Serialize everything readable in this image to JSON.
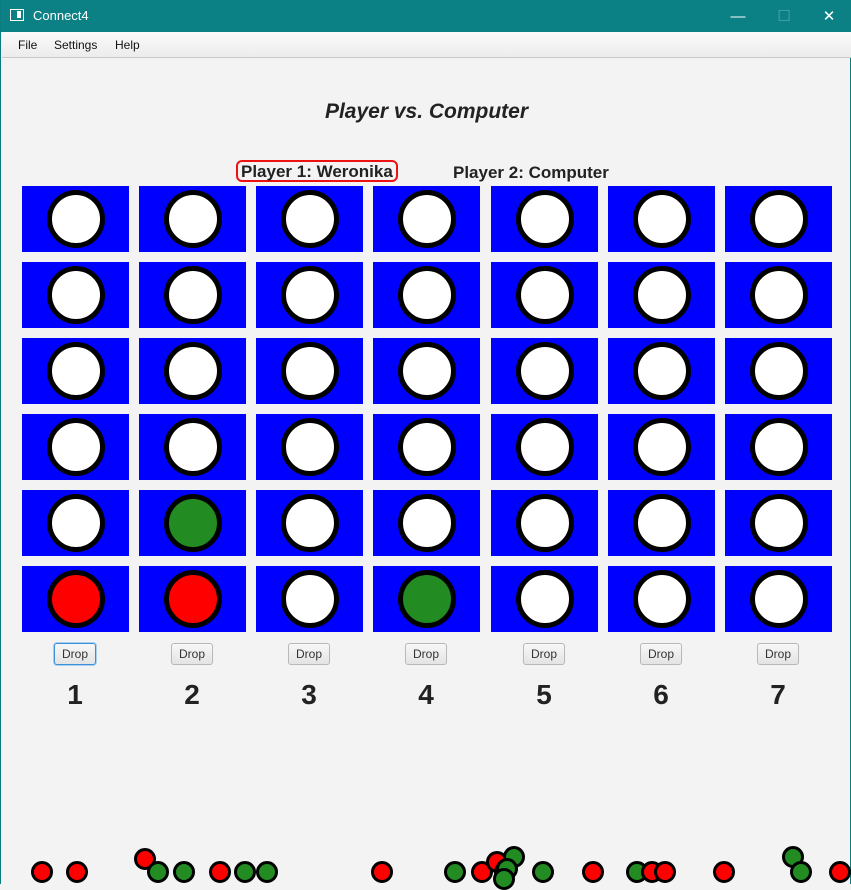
{
  "window": {
    "title": "Connect4",
    "minimize_icon": "minimize-icon",
    "maximize_icon": "maximize-icon",
    "close_icon": "close-icon",
    "minimize_glyph": "—",
    "maximize_glyph": "☐",
    "close_glyph": "✕"
  },
  "menu": [
    "File",
    "Settings",
    "Help"
  ],
  "game": {
    "mode_title": "Player vs. Computer",
    "player1": "Player 1: Weronika",
    "player2": "Player 2: Computer",
    "active_player": 1
  },
  "colors": {
    "board": "#0000ff",
    "empty": "#ffffff",
    "red": "#ff0000",
    "green": "#228b22",
    "active_highlight": "#ee1111"
  },
  "board": {
    "rows": 6,
    "cols": 7,
    "grid": [
      [
        "empty",
        "empty",
        "empty",
        "empty",
        "empty",
        "empty",
        "empty"
      ],
      [
        "empty",
        "empty",
        "empty",
        "empty",
        "empty",
        "empty",
        "empty"
      ],
      [
        "empty",
        "empty",
        "empty",
        "empty",
        "empty",
        "empty",
        "empty"
      ],
      [
        "empty",
        "empty",
        "empty",
        "empty",
        "empty",
        "empty",
        "empty"
      ],
      [
        "empty",
        "green",
        "empty",
        "empty",
        "empty",
        "empty",
        "empty"
      ],
      [
        "red",
        "red",
        "empty",
        "green",
        "empty",
        "empty",
        "empty"
      ]
    ]
  },
  "drop_label": "Drop",
  "columns": [
    "1",
    "2",
    "3",
    "4",
    "5",
    "6",
    "7"
  ],
  "focused_column": 1,
  "bouncing_discs": [
    "red",
    "red",
    "red",
    "green",
    "green",
    "red",
    "green",
    "green",
    "red",
    "green",
    "red",
    "red",
    "green",
    "green",
    "green",
    "green",
    "red",
    "green",
    "red",
    "red",
    "red",
    "green",
    "green",
    "red",
    "green"
  ]
}
